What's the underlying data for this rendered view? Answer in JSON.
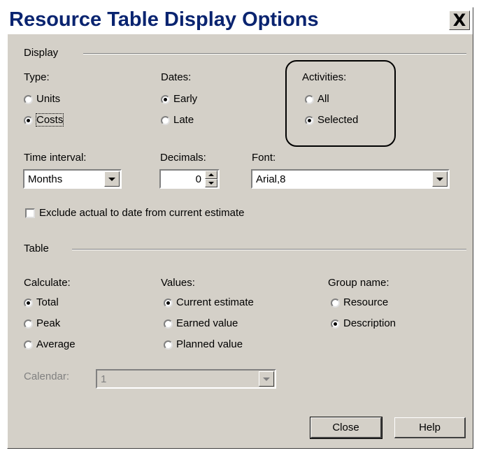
{
  "dialog": {
    "title": "Resource Table Display Options",
    "close_glyph": "X"
  },
  "display": {
    "section_label": "Display",
    "type": {
      "label": "Type:",
      "options": [
        "Units",
        "Costs"
      ],
      "selected": "Costs"
    },
    "dates": {
      "label": "Dates:",
      "options": [
        "Early",
        "Late"
      ],
      "selected": "Early"
    },
    "activities": {
      "label": "Activities:",
      "options": [
        "All",
        "Selected"
      ],
      "selected": "Selected"
    },
    "time_interval": {
      "label": "Time interval:",
      "value": "Months"
    },
    "decimals": {
      "label": "Decimals:",
      "value": "0"
    },
    "font": {
      "label": "Font:",
      "value": "Arial,8"
    },
    "exclude_checkbox": {
      "label": "Exclude actual to date from current estimate",
      "checked": false
    }
  },
  "table": {
    "section_label": "Table",
    "calculate": {
      "label": "Calculate:",
      "options": [
        "Total",
        "Peak",
        "Average"
      ],
      "selected": "Total"
    },
    "values": {
      "label": "Values:",
      "options": [
        "Current estimate",
        "Earned value",
        "Planned value"
      ],
      "selected": "Current estimate"
    },
    "group_name": {
      "label": "Group name:",
      "options": [
        "Resource",
        "Description"
      ],
      "selected": "Description"
    },
    "calendar": {
      "label": "Calendar:",
      "value": "1",
      "disabled": true
    }
  },
  "buttons": {
    "close": "Close",
    "help": "Help"
  }
}
